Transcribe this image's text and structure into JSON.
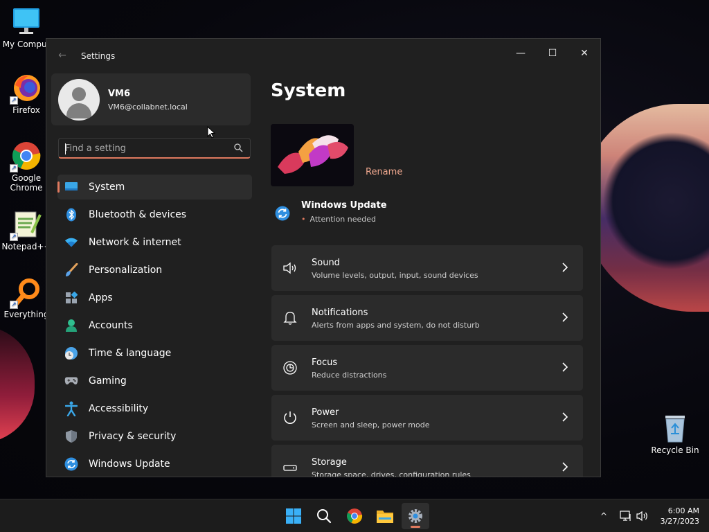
{
  "desktop": {
    "icons": [
      {
        "label": "My Comput",
        "icon": "monitor-icon"
      },
      {
        "label": "Firefox",
        "icon": "firefox-icon"
      },
      {
        "label": "Google Chrome",
        "icon": "chrome-icon"
      },
      {
        "label": "Notepad++",
        "icon": "notepad-plus-plus-icon"
      },
      {
        "label": "Everything",
        "icon": "everything-search-icon"
      },
      {
        "label": "Recycle Bin",
        "icon": "recycle-bin-icon"
      }
    ]
  },
  "window": {
    "title": "Settings",
    "controls": {
      "minimize": "—",
      "maximize": "☐",
      "close": "✕"
    }
  },
  "profile": {
    "name": "VM6",
    "email": "VM6@collabnet.local"
  },
  "search": {
    "placeholder": "Find a setting",
    "value": ""
  },
  "nav": {
    "items": [
      {
        "label": "System",
        "icon": "system-display-icon",
        "active": true
      },
      {
        "label": "Bluetooth & devices",
        "icon": "bluetooth-icon"
      },
      {
        "label": "Network & internet",
        "icon": "wifi-icon"
      },
      {
        "label": "Personalization",
        "icon": "brush-icon"
      },
      {
        "label": "Apps",
        "icon": "apps-icon"
      },
      {
        "label": "Accounts",
        "icon": "account-icon"
      },
      {
        "label": "Time & language",
        "icon": "clock-globe-icon"
      },
      {
        "label": "Gaming",
        "icon": "gamepad-icon"
      },
      {
        "label": "Accessibility",
        "icon": "accessibility-icon"
      },
      {
        "label": "Privacy & security",
        "icon": "shield-icon"
      },
      {
        "label": "Windows Update",
        "icon": "update-icon"
      }
    ]
  },
  "main": {
    "title": "System",
    "rename_label": "Rename",
    "windows_update": {
      "title": "Windows Update",
      "status": "Attention needed"
    },
    "cards": [
      {
        "title": "Sound",
        "subtitle": "Volume levels, output, input, sound devices",
        "icon": "speaker-icon"
      },
      {
        "title": "Notifications",
        "subtitle": "Alerts from apps and system, do not disturb",
        "icon": "bell-icon"
      },
      {
        "title": "Focus",
        "subtitle": "Reduce distractions",
        "icon": "focus-icon"
      },
      {
        "title": "Power",
        "subtitle": "Screen and sleep, power mode",
        "icon": "power-icon"
      },
      {
        "title": "Storage",
        "subtitle": "Storage space, drives, configuration rules",
        "icon": "storage-icon"
      }
    ]
  },
  "taskbar": {
    "apps": [
      {
        "name": "Start",
        "icon": "windows-start-icon"
      },
      {
        "name": "Search",
        "icon": "search-icon"
      },
      {
        "name": "Google Chrome",
        "icon": "chrome-icon"
      },
      {
        "name": "File Explorer",
        "icon": "folder-icon"
      },
      {
        "name": "Settings",
        "icon": "gear-icon",
        "active": true
      }
    ],
    "tray": {
      "chevron": "^",
      "time": "6:00 AM",
      "date": "3/27/2023"
    }
  },
  "colors": {
    "accent": "#e07a5f",
    "window_bg": "#202020",
    "card_bg": "#2b2b2b",
    "rename": "#f1a98f"
  }
}
